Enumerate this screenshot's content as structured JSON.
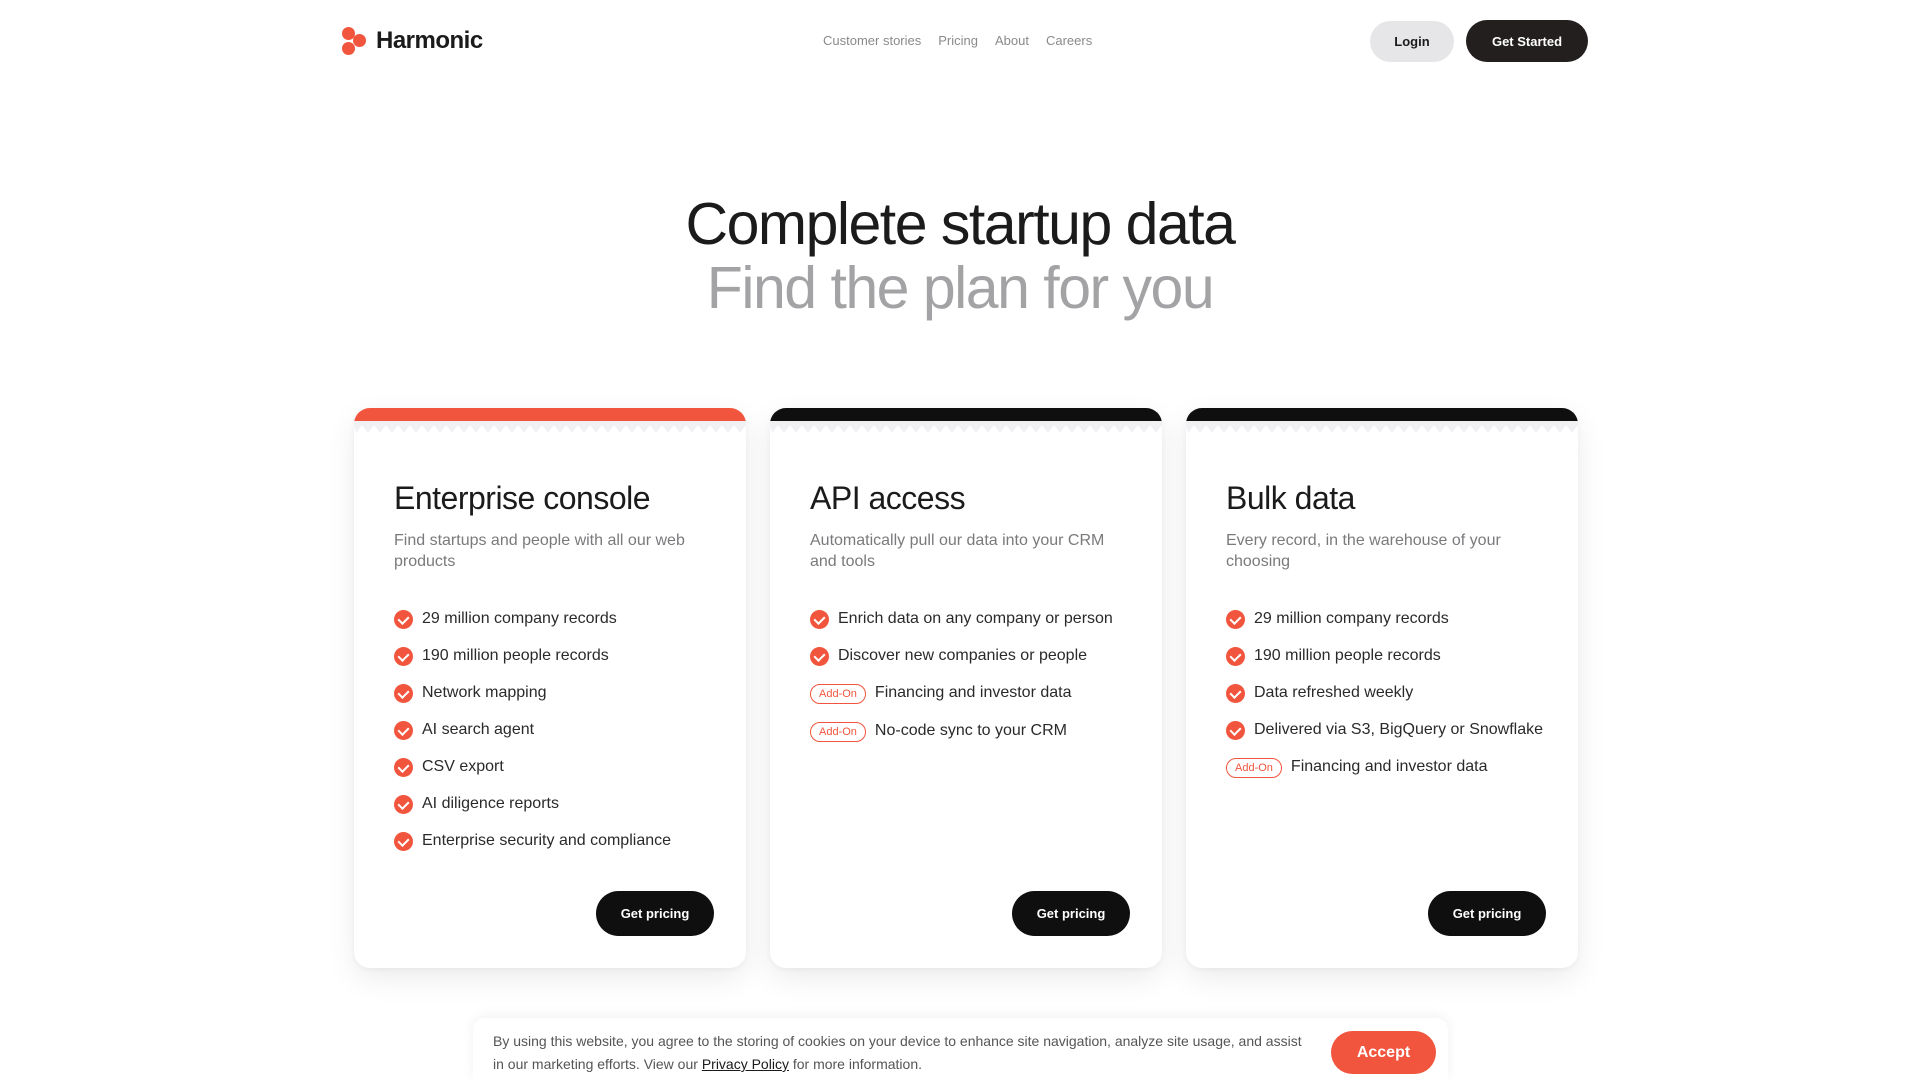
{
  "header": {
    "logo_text": "Harmonic",
    "nav": [
      "Customer stories",
      "Pricing",
      "About",
      "Careers"
    ],
    "login_label": "Login",
    "get_started_label": "Get Started"
  },
  "hero": {
    "title": "Complete startup data",
    "subtitle": "Find the plan for you"
  },
  "cards": [
    {
      "title": "Enterprise console",
      "subtitle": "Find startups and people with all our web products",
      "accent_color": "#f2553d",
      "features": [
        {
          "type": "check",
          "text": "29 million company records"
        },
        {
          "type": "check",
          "text": "190 million people records"
        },
        {
          "type": "check",
          "text": "Network mapping"
        },
        {
          "type": "check",
          "text": "AI search agent"
        },
        {
          "type": "check",
          "text": "CSV export"
        },
        {
          "type": "check",
          "text": "AI diligence reports"
        },
        {
          "type": "check",
          "text": "Enterprise security and compliance"
        }
      ],
      "button_label": "Get pricing"
    },
    {
      "title": "API access",
      "subtitle": "Automatically pull our data into your CRM and tools",
      "accent_color": "#0f0f0f",
      "features": [
        {
          "type": "check",
          "text": "Enrich data on any company or person"
        },
        {
          "type": "check",
          "text": "Discover new companies or people"
        },
        {
          "type": "addon",
          "badge": "Add-On",
          "text": "Financing and investor data"
        },
        {
          "type": "addon",
          "badge": "Add-On",
          "text": "No-code sync to your CRM"
        }
      ],
      "button_label": "Get pricing"
    },
    {
      "title": "Bulk data",
      "subtitle": "Every record, in the warehouse of your choosing",
      "accent_color": "#0f0f0f",
      "features": [
        {
          "type": "check",
          "text": "29 million company records"
        },
        {
          "type": "check",
          "text": "190 million people records"
        },
        {
          "type": "check",
          "text": "Data refreshed weekly"
        },
        {
          "type": "check",
          "text": "Delivered via S3, BigQuery or Snowflake"
        },
        {
          "type": "addon",
          "badge": "Add-On",
          "text": "Financing and investor data"
        }
      ],
      "button_label": "Get pricing"
    }
  ],
  "cookie": {
    "text_before": "By using this website, you agree to the storing of cookies on your device to enhance site navigation, analyze site usage, and assist in our marketing efforts. View our ",
    "link_label": "Privacy Policy",
    "text_after": " for more information.",
    "accept_label": "Accept"
  },
  "colors": {
    "accent": "#f2553d",
    "dark": "#0f0f0f"
  }
}
